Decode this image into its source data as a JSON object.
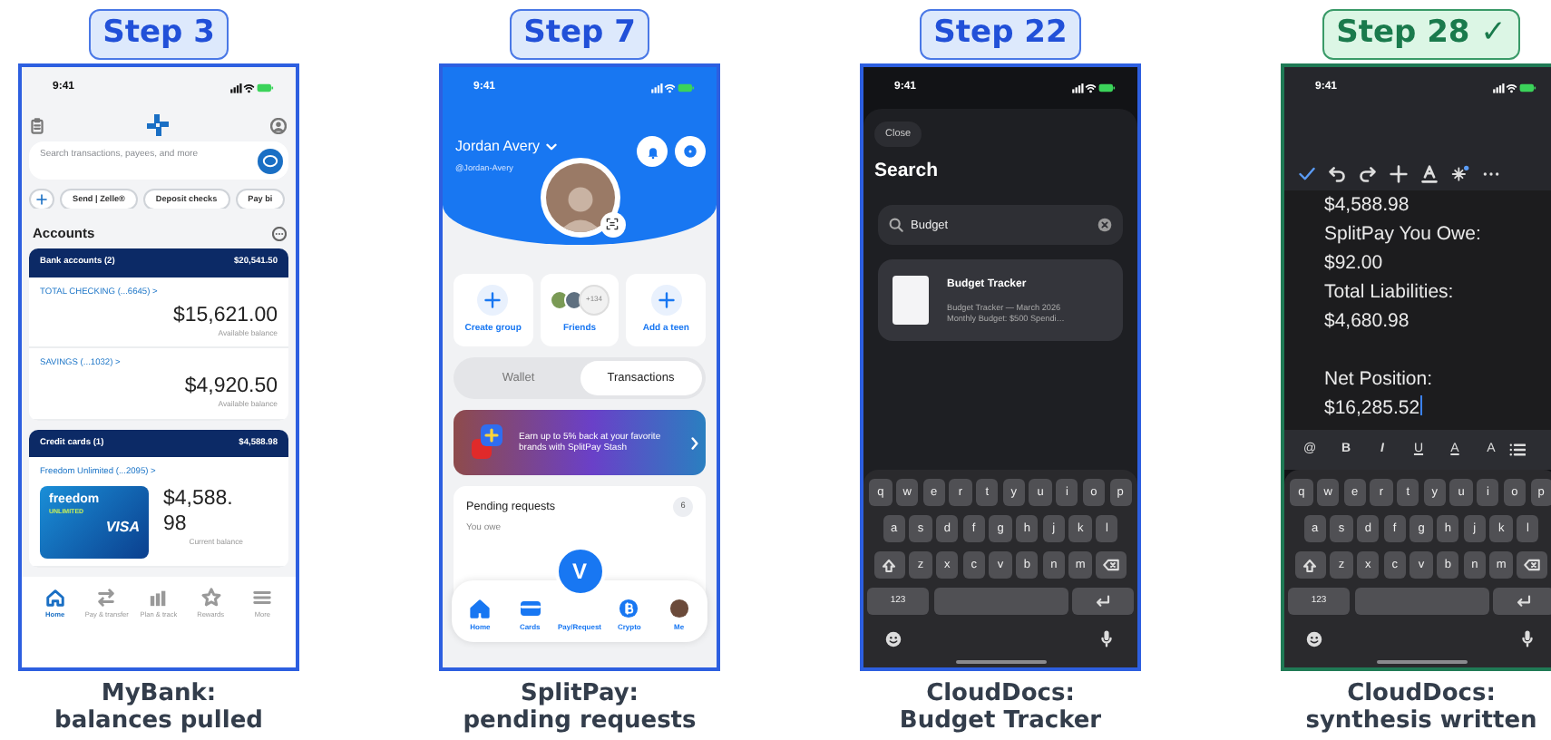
{
  "panels": [
    {
      "kind": "bank",
      "step": "Step 3",
      "complete": false,
      "caption": [
        "MyBank:",
        "balances pulled"
      ],
      "time": "9:41",
      "search_placeholder": "Search transactions, payees, and more",
      "chips": [
        "Send | Zelle®",
        "Deposit checks",
        "Pay bi"
      ],
      "section_title": "Accounts",
      "groups": [
        {
          "title": "Bank accounts (2)",
          "total": "$20,541.50",
          "accounts": [
            {
              "name": "TOTAL CHECKING (...6645) >",
              "amount": "$15,621.00",
              "note": "Available balance"
            },
            {
              "name": "SAVINGS (...1032) >",
              "amount": "$4,920.50",
              "note": "Available balance"
            }
          ]
        },
        {
          "title": "Credit cards (1)",
          "total": "$4,588.98",
          "accounts": [
            {
              "name": "Freedom Unlimited (...2095) >",
              "amount": "$4,588.98",
              "note": "Current balance",
              "card": {
                "brand": "freedom",
                "tier": "UNLIMITED",
                "network": "VISA"
              }
            }
          ]
        }
      ],
      "nav": [
        {
          "label": "Home",
          "selected": true
        },
        {
          "label": "Pay & transfer",
          "selected": false
        },
        {
          "label": "Plan & track",
          "selected": false
        },
        {
          "label": "Rewards",
          "selected": false
        },
        {
          "label": "More",
          "selected": false
        }
      ]
    },
    {
      "kind": "splitpay",
      "step": "Step 7",
      "complete": false,
      "caption": [
        "SplitPay:",
        "pending requests"
      ],
      "time": "9:41",
      "name": "Jordan Avery",
      "handle": "@Jordan-Avery",
      "actions": [
        {
          "label": "Create group"
        },
        {
          "label": "Friends",
          "count": "+134"
        },
        {
          "label": "Add a teen"
        }
      ],
      "segments": [
        {
          "label": "Wallet",
          "selected": false
        },
        {
          "label": "Transactions",
          "selected": true
        }
      ],
      "promo": "Earn up to 5% back at your favorite brands with SplitPay Stash",
      "pending": {
        "title": "Pending requests",
        "count": "6",
        "subtitle": "You owe"
      },
      "fab": "V",
      "nav": [
        "Home",
        "Cards",
        "Pay/Request",
        "Crypto",
        "Me"
      ]
    },
    {
      "kind": "search",
      "step": "Step 22",
      "complete": false,
      "caption": [
        "CloudDocs:",
        "Budget Tracker"
      ],
      "time": "9:41",
      "close": "Close",
      "title": "Search",
      "query": "Budget",
      "results": [
        {
          "title": "Budget Tracker",
          "lines": [
            "Budget Tracker — March 2026",
            "Monthly Budget: $500  Spendi…"
          ]
        }
      ],
      "keyboard": {
        "rows": [
          [
            "q",
            "w",
            "e",
            "r",
            "t",
            "y",
            "u",
            "i",
            "o",
            "p"
          ],
          [
            "a",
            "s",
            "d",
            "f",
            "g",
            "h",
            "j",
            "k",
            "l"
          ],
          [
            "z",
            "x",
            "c",
            "v",
            "b",
            "n",
            "m"
          ]
        ],
        "numbers": "123"
      }
    },
    {
      "kind": "editor",
      "step": "Step 28 ✓",
      "complete": true,
      "caption": [
        "CloudDocs:",
        "synthesis written"
      ],
      "time": "9:41",
      "blocks": [
        [
          "$4,588.98",
          "SplitPay You Owe:",
          "$92.00",
          "Total Liabilities:",
          "$4,680.98"
        ],
        [
          "Net Position:",
          "$16,285.52"
        ]
      ],
      "format_keys": [
        {
          "label": "@",
          "kind": "mention"
        },
        {
          "label": "B",
          "kind": "bold"
        },
        {
          "label": "I",
          "kind": "italic"
        },
        {
          "label": "U",
          "kind": "underline"
        },
        {
          "label": "A",
          "kind": "color"
        },
        {
          "label": "A",
          "kind": "font"
        }
      ],
      "keyboard": {
        "rows": [
          [
            "q",
            "w",
            "e",
            "r",
            "t",
            "y",
            "u",
            "i",
            "o",
            "p"
          ],
          [
            "a",
            "s",
            "d",
            "f",
            "g",
            "h",
            "j",
            "k",
            "l"
          ],
          [
            "z",
            "x",
            "c",
            "v",
            "b",
            "n",
            "m"
          ]
        ],
        "numbers": "123"
      }
    }
  ]
}
